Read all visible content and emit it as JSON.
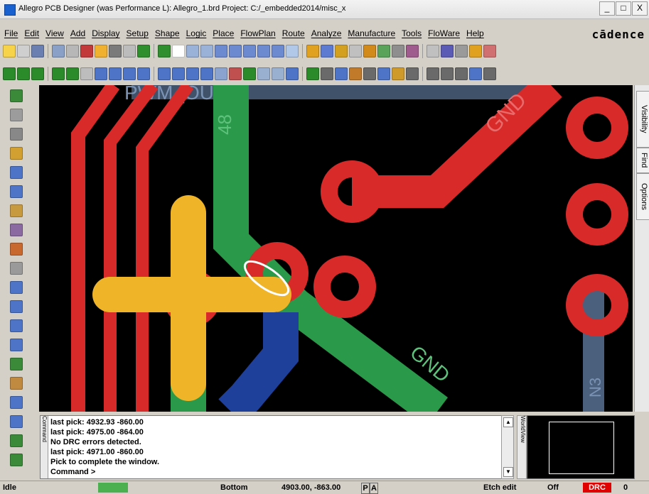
{
  "window": {
    "title": "Allegro PCB Designer (was Performance L): Allegro_1.brd  Project: C:/_embedded2014/misc_x",
    "controls": [
      "_",
      "□",
      "X"
    ]
  },
  "menu": {
    "items": [
      "File",
      "Edit",
      "View",
      "Add",
      "Display",
      "Setup",
      "Shape",
      "Logic",
      "Place",
      "FlowPlan",
      "Route",
      "Analyze",
      "Manufacture",
      "Tools",
      "FloWare",
      "Help"
    ],
    "brand": "cādence"
  },
  "toolbar1_colors": [
    "#f7d34a",
    "#cfcfcf",
    "#6b7fb0",
    "#8aa0c7",
    "#b7b7b7",
    "#c23a3a",
    "#f0b030",
    "#7a7a7a",
    "#bcbcbc",
    "#2f8f2f",
    "#2f8f2f",
    "#ffffff",
    "#9ab2d8",
    "#9ab2d8",
    "#6c8ad0",
    "#6c8ad0",
    "#6c8ad0",
    "#6c8ad0",
    "#6c8ad0",
    "#b2c8e8",
    "#e0a020",
    "#5c7bd1",
    "#d4a020",
    "#c0c0c0",
    "#d28a1a",
    "#5aa35a",
    "#8e8e8e",
    "#a05b8e",
    "#c0c0c0",
    "#5b5bb5",
    "#9a9a9a",
    "#e0a020",
    "#d07070"
  ],
  "toolbar2_colors": [
    "#2b8b2b",
    "#2b8b2b",
    "#2b8b2b",
    "#2b8b2b",
    "#2b8b2b",
    "#bdbdbd",
    "#4d74c7",
    "#4d74c7",
    "#4d74c7",
    "#4d74c7",
    "#4d74c7",
    "#4d74c7",
    "#4d74c7",
    "#4d74c7",
    "#8aa4cf",
    "#c05050",
    "#2b8b2b",
    "#9ab0d0",
    "#9ab0d0",
    "#4d74c7",
    "#2b8b2b",
    "#6a6a6a",
    "#4d74c7",
    "#c07a2a",
    "#6a6a6a",
    "#4d74c7",
    "#d09a2a",
    "#6a6a6a",
    "#6a6a6a",
    "#6a6a6a",
    "#6a6a6a",
    "#4d74c7",
    "#6a6a6a"
  ],
  "left_tool_colors": [
    "#3a8a3a",
    "#9c9c9c",
    "#888888",
    "#d2a030",
    "#4d74c7",
    "#4d74c7",
    "#c89a40",
    "#8a6aa0",
    "#c86a30",
    "#9a9a9a",
    "#4d74c7",
    "#4d74c7",
    "#4d74c7",
    "#4d74c7",
    "#3a8a3a",
    "#c08a40",
    "#4d74c7",
    "#4d74c7",
    "#3a8a3a",
    "#3a8a3a"
  ],
  "right_tabs": [
    "Visibility",
    "Find",
    "Options"
  ],
  "board": {
    "labels": {
      "pwm_out": "PWM_OUT",
      "gnd_top": "GND",
      "gnd_mid": "GND",
      "net_48": "48",
      "net_3": "N3"
    }
  },
  "command": {
    "tab_label": "Command",
    "lines": [
      "last pick:  4932.93 -860.00",
      "last pick:  4975.00 -864.00",
      "No DRC errors detected.",
      "last pick:  4971.00 -860.00",
      "Pick to complete the window.",
      "Command >"
    ]
  },
  "worldview": {
    "tab_label": "WorldView"
  },
  "status": {
    "state": "Idle",
    "layer": "Bottom",
    "coords": "4903.00, -863.00",
    "mode_p": "P",
    "mode_a": "A",
    "edit_mode": "Etch edit",
    "toggle": "Off",
    "drc": "DRC",
    "count": "0"
  }
}
